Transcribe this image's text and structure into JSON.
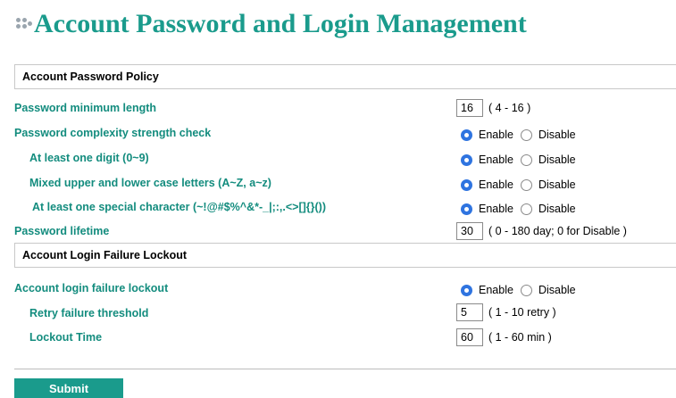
{
  "page": {
    "title": "Account Password and Login Management"
  },
  "policy_section": {
    "title": "Account Password Policy"
  },
  "min_length": {
    "label": "Password minimum length",
    "value": "16",
    "hint": "( 4 - 16 )"
  },
  "complexity": {
    "label": "Password complexity strength check",
    "enable": "Enable",
    "disable": "Disable",
    "selected": "enable"
  },
  "digit": {
    "label": "At least one digit (0~9)",
    "enable": "Enable",
    "disable": "Disable",
    "selected": "enable"
  },
  "mixed_case": {
    "label": "Mixed upper and lower case letters (A~Z, a~z)",
    "enable": "Enable",
    "disable": "Disable",
    "selected": "enable"
  },
  "special_char": {
    "label": "At least one special character (~!@#$%^&*-_|;:,.<>[]{}())",
    "enable": "Enable",
    "disable": "Disable",
    "selected": "enable"
  },
  "lifetime": {
    "label": "Password lifetime",
    "value": "30",
    "hint": "( 0 - 180 day; 0 for Disable )"
  },
  "lockout_section": {
    "title": "Account Login Failure Lockout"
  },
  "lockout": {
    "label": "Account login failure lockout",
    "enable": "Enable",
    "disable": "Disable",
    "selected": "enable"
  },
  "retry": {
    "label": "Retry failure threshold",
    "value": "5",
    "hint": "( 1 - 10 retry )"
  },
  "lockout_time": {
    "label": "Lockout Time",
    "value": "60",
    "hint": "( 1 - 60 min )"
  },
  "submit": {
    "label": "Submit"
  },
  "colors": {
    "title": "#1a9b8c",
    "label": "#138c7e",
    "radio_selected": "#2f74e0",
    "button": "#1a9b8c"
  }
}
